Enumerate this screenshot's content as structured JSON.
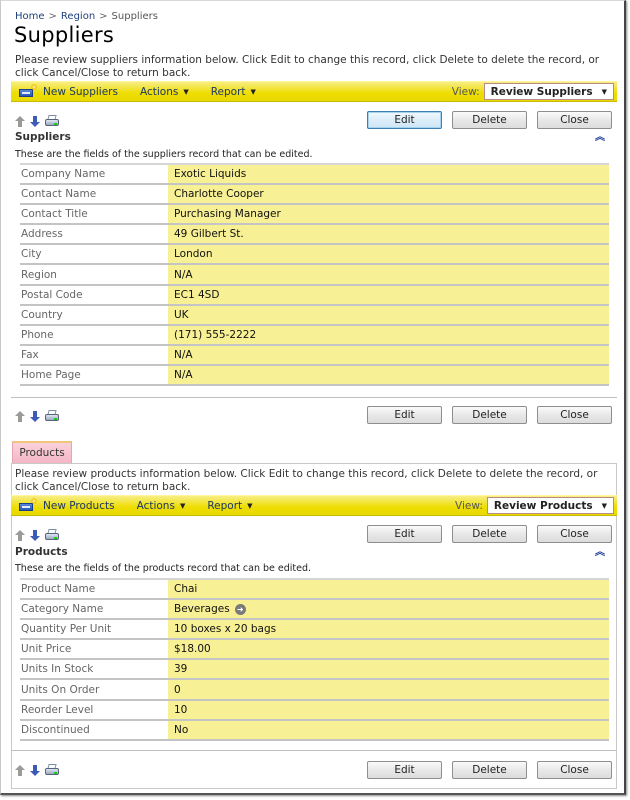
{
  "breadcrumb": {
    "items": [
      "Home",
      "Region",
      "Suppliers"
    ],
    "separator": ">"
  },
  "page_title": "Suppliers",
  "suppliers": {
    "description": "Please review suppliers information below. Click Edit to change this record, click Delete to delete the record, or click Cancel/Close to return back.",
    "toolbar": {
      "new_label": "New Suppliers",
      "actions_label": "Actions",
      "report_label": "Report",
      "view_label": "View:",
      "view_value": "Review Suppliers"
    },
    "buttons": {
      "edit": "Edit",
      "delete": "Delete",
      "close": "Close"
    },
    "section_title": "Suppliers",
    "section_desc": "These are the fields of the suppliers record that can be edited.",
    "fields": [
      {
        "label": "Company Name",
        "value": "Exotic Liquids"
      },
      {
        "label": "Contact Name",
        "value": "Charlotte Cooper"
      },
      {
        "label": "Contact Title",
        "value": "Purchasing Manager"
      },
      {
        "label": "Address",
        "value": "49 Gilbert St."
      },
      {
        "label": "City",
        "value": "London"
      },
      {
        "label": "Region",
        "value": "N/A"
      },
      {
        "label": "Postal Code",
        "value": "EC1 4SD"
      },
      {
        "label": "Country",
        "value": "UK"
      },
      {
        "label": "Phone",
        "value": "(171) 555-2222"
      },
      {
        "label": "Fax",
        "value": "N/A"
      },
      {
        "label": "Home Page",
        "value": "N/A"
      }
    ]
  },
  "products": {
    "tab_label": "Products",
    "description": "Please review products information below. Click Edit to change this record, click Delete to delete the record, or click Cancel/Close to return back.",
    "toolbar": {
      "new_label": "New Products",
      "actions_label": "Actions",
      "report_label": "Report",
      "view_label": "View:",
      "view_value": "Review Products"
    },
    "buttons": {
      "edit": "Edit",
      "delete": "Delete",
      "close": "Close"
    },
    "section_title": "Products",
    "section_desc": "These are the fields of the products record that can be edited.",
    "fields": [
      {
        "label": "Product Name",
        "value": "Chai"
      },
      {
        "label": "Category Name",
        "value": "Beverages",
        "link_icon": "arrow-right-circle-icon"
      },
      {
        "label": "Quantity Per Unit",
        "value": "10 boxes x 20 bags"
      },
      {
        "label": "Unit Price",
        "value": "$18.00"
      },
      {
        "label": "Units In Stock",
        "value": "39"
      },
      {
        "label": "Units On Order",
        "value": "0"
      },
      {
        "label": "Reorder Level",
        "value": "10"
      },
      {
        "label": "Discontinued",
        "value": "No"
      }
    ]
  },
  "icons": {
    "new": "new-record-icon",
    "prev": "arrow-up-icon",
    "next": "arrow-down-icon",
    "print": "printer-icon",
    "collapse": "double-chevron-up-icon",
    "dropdown": "caret-down-icon"
  },
  "colors": {
    "toolbar_yellow": "#eedd00",
    "field_value_bg": "#f8f094",
    "tab_pink": "#f5b6c6",
    "link_blue": "#1f3f7a"
  }
}
